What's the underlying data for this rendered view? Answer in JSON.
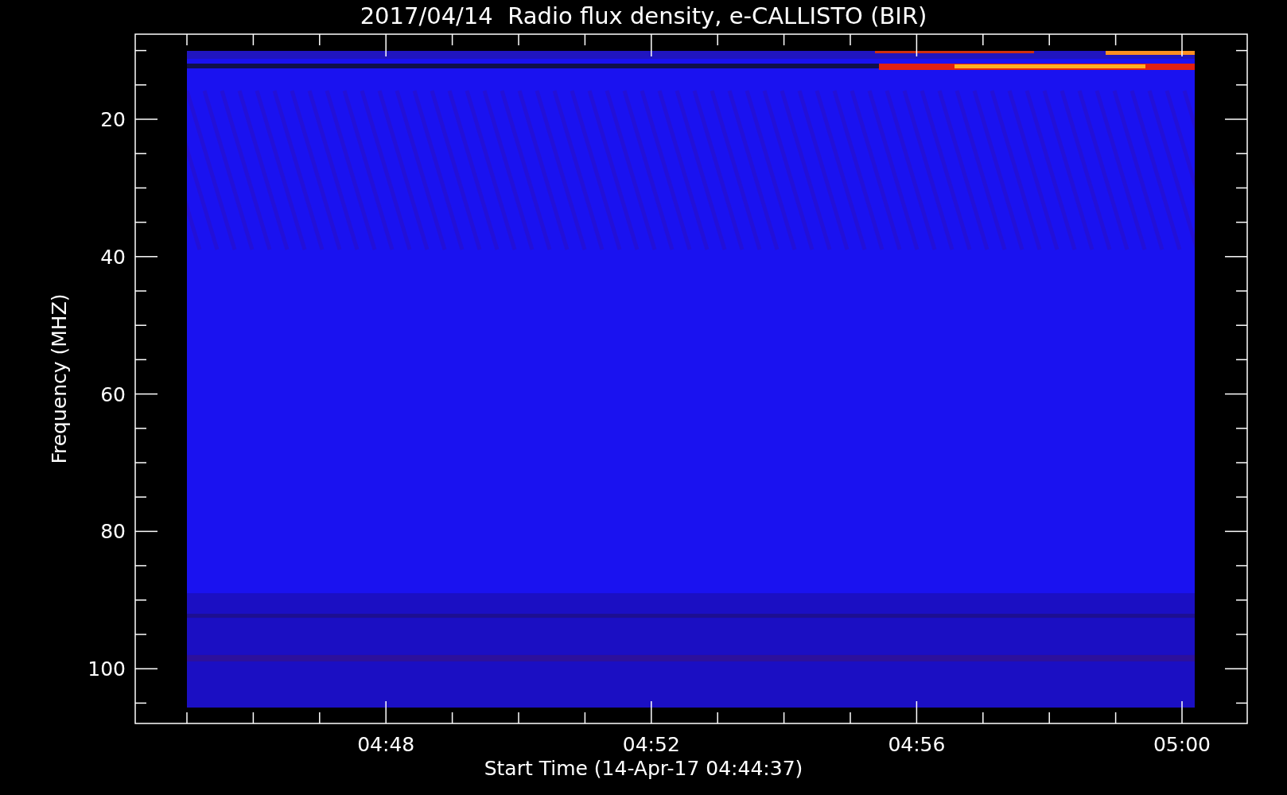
{
  "title": "2017/04/14  Radio flux density, e-CALLISTO (BIR)",
  "y_axis": {
    "label": "Frequency (MHZ)",
    "ticks": [
      "20",
      "40",
      "60",
      "80",
      "100"
    ]
  },
  "x_axis": {
    "label": "Start Time (14-Apr-17 04:44:37)",
    "ticks": [
      "04:48",
      "04:52",
      "04:56",
      "05:00"
    ]
  }
}
